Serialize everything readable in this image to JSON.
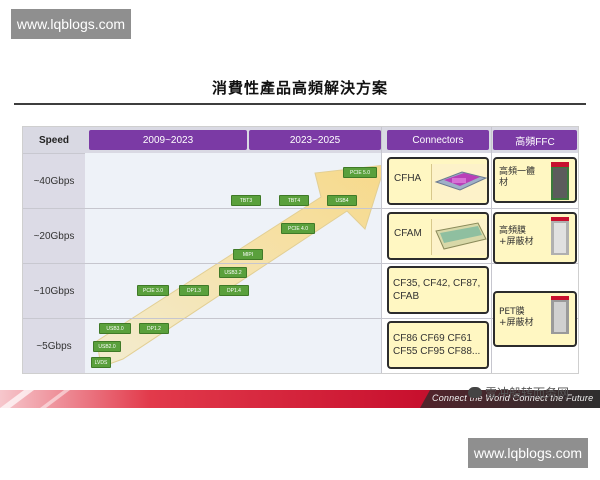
{
  "watermarks": {
    "top": "www.lqblogs.com",
    "bottom": "www.lqblogs.com"
  },
  "slide": {
    "title": "消費性產品高頻解決方案",
    "header": {
      "speed": "Speed",
      "period1": "2009~2023",
      "period2": "2023~2025",
      "connectors": "Connectors",
      "ffc": "高頻FFC"
    },
    "speeds": [
      "~40Gbps",
      "~20Gbps",
      "~10Gbps",
      "~5Gbps"
    ],
    "tech_labels": [
      "PCIE 5.0",
      "TBT3",
      "TBT4",
      "USB4",
      "PCIE 4.0",
      "MIPI",
      "USB3.2",
      "PCIE 3.0",
      "DP1.3",
      "DP1.4",
      "USB3.0",
      "DP1.2",
      "USB2.0",
      "LVDS"
    ],
    "connectors": {
      "cfha": "CFHA",
      "cfam": "CFAM",
      "row3": "CF35, CF42, CF87, CFAB",
      "row4": "CF86 CF69 CF61 CF55 CF95 CF88..."
    },
    "ffc": {
      "item1": "高頻一體材",
      "item2": "高頻膜+屏蔽材",
      "item3": "PET膜+屏蔽材"
    }
  },
  "banner": {
    "text": "Connect the World Connect the Future",
    "weibo": "雪冲船转而务网"
  },
  "colors": {
    "header_purple": "#7b3aa5",
    "tech_green": "#5aa03c",
    "connector_yellow": "#fff7c2",
    "banner_red": "#c8102e"
  }
}
